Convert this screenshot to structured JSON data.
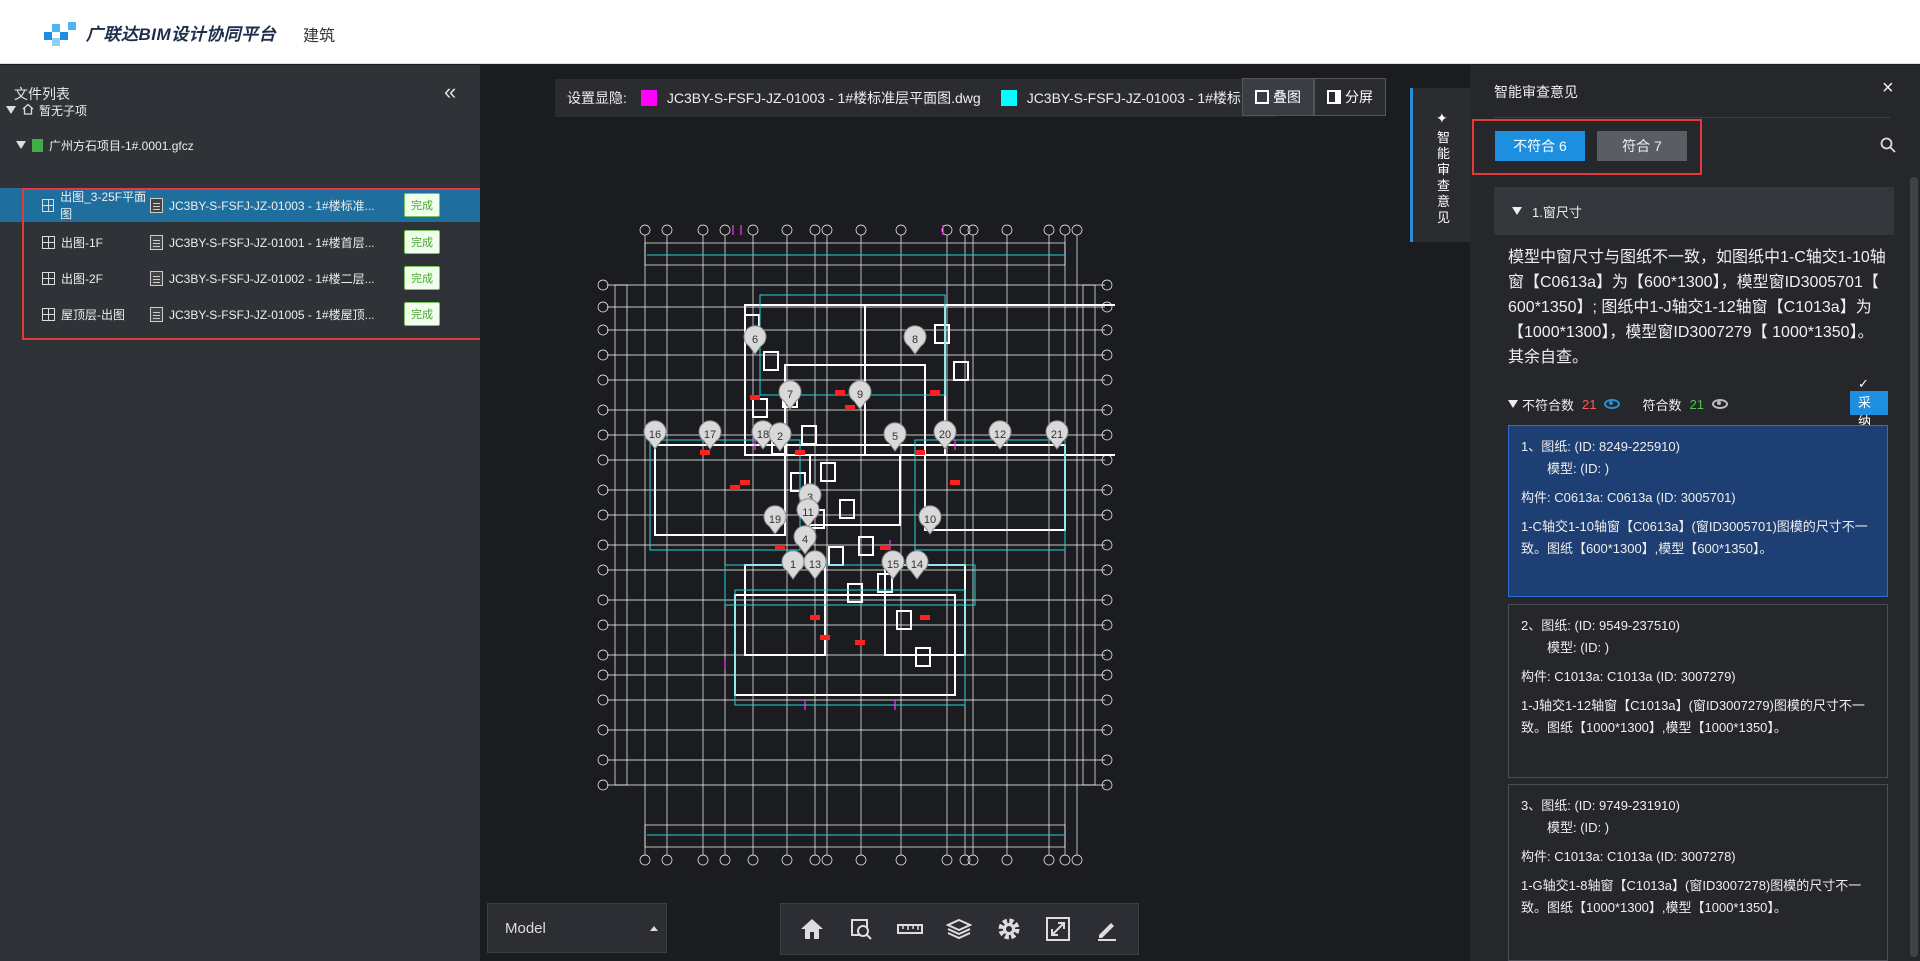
{
  "header": {
    "logo_text": "广联达BIM设计协同平台",
    "nav_item": "建筑"
  },
  "sidebar": {
    "title": "文件列表",
    "collapse_icon": "«",
    "tree": {
      "root_label": "暂无子项",
      "project_label": "广州方石项目-1#.0001.gfcz"
    },
    "files": [
      {
        "name": "出图_3-25F平面图",
        "file": "JC3BY-S-FSFJ-JZ-01003 - 1#楼标准...",
        "status": "完成"
      },
      {
        "name": "出图-1F",
        "file": "JC3BY-S-FSFJ-JZ-01001 - 1#楼首层...",
        "status": "完成"
      },
      {
        "name": "出图-2F",
        "file": "JC3BY-S-FSFJ-JZ-01002 - 1#楼二层...",
        "status": "完成"
      },
      {
        "name": "屋顶层-出图",
        "file": "JC3BY-S-FSFJ-JZ-01005 - 1#楼屋顶...",
        "status": "完成"
      }
    ]
  },
  "viewer": {
    "legend_label": "设置显隐:",
    "legend_items": [
      {
        "text": "JC3BY-S-FSFJ-JZ-01003 - 1#楼标准层平面图.dwg",
        "color": "#ff00ff"
      },
      {
        "text": "JC3BY-S-FSFJ-JZ-01003 - 1#楼标",
        "color": "#00ffff"
      }
    ],
    "btn_overlay": "叠图",
    "btn_split": "分屏",
    "markers": [
      "6",
      "8",
      "7",
      "9",
      "16",
      "17",
      "18",
      "2",
      "5",
      "20",
      "12",
      "21",
      "3",
      "11",
      "19",
      "10",
      "4",
      "1",
      "13",
      "15",
      "14"
    ],
    "model_select": "Model",
    "tools": [
      "home-icon",
      "zoom-window-icon",
      "measure-icon",
      "layers-icon",
      "settings-icon",
      "fullscreen-icon",
      "annotate-icon"
    ]
  },
  "side_tab": {
    "label": "智能审查意见"
  },
  "review": {
    "title": "智能审查意见",
    "close": "×",
    "tab_noncompliant": "不符合 6",
    "tab_compliant": "符合 7",
    "section_title": "1.窗尺寸",
    "description": "模型中窗尺寸与图纸不一致，如图纸中1-C轴交1-10轴窗【C0613a】为【600*1300】，模型窗ID3005701【 600*1350】; 图纸中1-J轴交1-12轴窗【C1013a】为【1000*1300】，模型窗ID3007279【 1000*1350】。其余自查。",
    "noncompliant_label": "不符合数",
    "noncompliant_count": "21",
    "compliant_label": "符合数",
    "compliant_count": "21",
    "adopt_label": "✓采纳",
    "items": [
      {
        "l1": "1、图纸: (ID: 8249-225910)",
        "l2": "模型: (ID: )",
        "l3": "构件: C0613a: C0613a (ID: 3005701)",
        "l4": "1-C轴交1-10轴窗【C0613a】(窗ID3005701)图模的尺寸不一致。图纸【600*1300】,模型【600*1350】。"
      },
      {
        "l1": "2、图纸: (ID: 9549-237510)",
        "l2": "模型: (ID: )",
        "l3": "构件: C1013a: C1013a (ID: 3007279)",
        "l4": "1-J轴交1-12轴窗【C1013a】(窗ID3007279)图模的尺寸不一致。图纸【1000*1300】,模型【1000*1350】。"
      },
      {
        "l1": "3、图纸: (ID: 9749-231910)",
        "l2": "模型: (ID: )",
        "l3": "构件: C1013a: C1013a (ID: 3007278)",
        "l4": "1-G轴交1-8轴窗【C1013a】(窗ID3007278)图模的尺寸不一致。图纸【1000*1300】,模型【1000*1350】。"
      }
    ]
  }
}
